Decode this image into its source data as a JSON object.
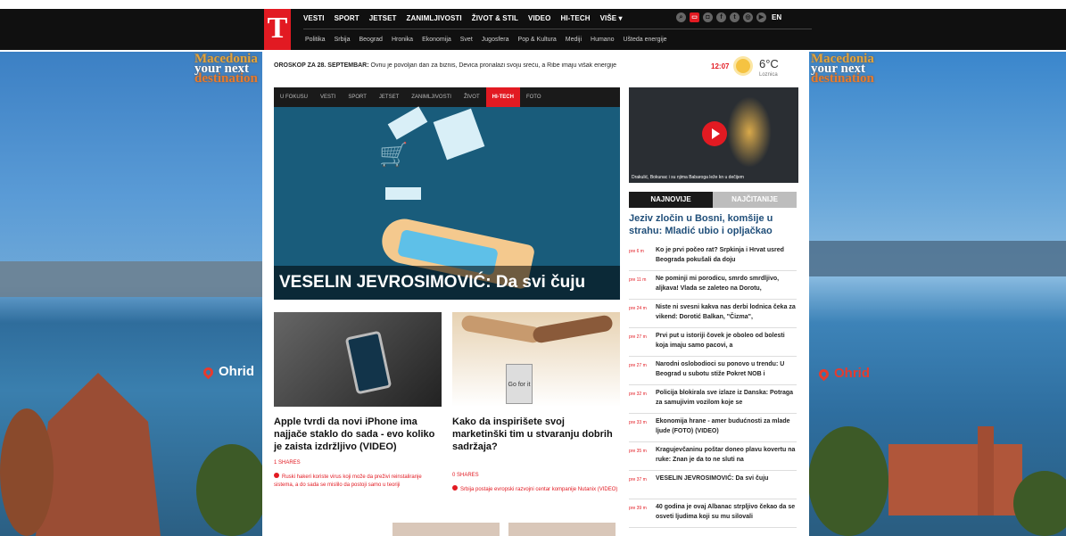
{
  "ad": {
    "brand_line1": "Macedonia",
    "brand_line2": "your next",
    "brand_line3": "destination",
    "pin_label": "Ohrid"
  },
  "header": {
    "logo": "T",
    "nav_main": [
      "VESTI",
      "SPORT",
      "JETSET",
      "ZANIMLJIVOSTI",
      "ŽIVOT & STIL",
      "VIDEO",
      "HI-TECH",
      "VIŠE ▾"
    ],
    "nav_sub": [
      "Politika",
      "Srbija",
      "Beograd",
      "Hronika",
      "Ekonomija",
      "Svet",
      "Jugosfera",
      "Pop & Kultura",
      "Mediji",
      "Humano",
      "Ušteda energije"
    ],
    "lang": "EN"
  },
  "ticker": {
    "label": "OROSKOP ZA 28. SEPTEMBAR:",
    "text": " Ovnu je povoljan dan za biznis, Devica pronalazi svoju sreću, a Ribe imaju višak energije",
    "time": "12:07"
  },
  "weather": {
    "temp": "6°C",
    "city": "Loznica"
  },
  "hero": {
    "tabs": [
      "U FOKUSU",
      "VESTI",
      "SPORT",
      "JETSET",
      "ZANIMLJIVOSTI",
      "ŽIVOT",
      "HI-TECH",
      "FOTO"
    ],
    "active_tab": "HI-TECH",
    "title": "VESELIN JEVROSIMOVIĆ: Da svi čuju"
  },
  "video": {
    "caption": "Drakulić, Bokunac i su njima Babaroga leže kn u dečijem"
  },
  "right": {
    "tab_latest": "NAJNOVIJE",
    "tab_read": "NAJČITANIJE",
    "headline": "Jeziv zločin u Bosni, komšije u strahu: Mladić ubio i opljačkao",
    "items": [
      {
        "time": "pre 6 m",
        "text": "Ko je prvi počeo rat? Srpkinja i Hrvat usred Beograda pokušali da doju"
      },
      {
        "time": "pre 11 m",
        "text": "Ne pominji mi porodicu, smrdo smrdljivo, aljkava! Vlada se zaleteo na Dorotu,"
      },
      {
        "time": "pre 24 m",
        "text": "Niste ni svesni kakva nas derbi lodnica čeka za vikend: Dorotić Balkan, \"Čizma\","
      },
      {
        "time": "pre 27 m",
        "text": "Prvi put u istoriji čovek je oboleo od bolesti koja imaju samo pacovi, a"
      },
      {
        "time": "pre 27 m",
        "text": "Narodni oslobodioci su ponovo u trendu: U Beograd u subotu stiže Pokret NOB i"
      },
      {
        "time": "pre 32 m",
        "text": "Policija blokirala sve izlaze iz Danska: Potraga za samujivim vozilom koje se"
      },
      {
        "time": "pre 33 m",
        "text": "Ekonomija hrane - amer budućnosti za mlade ljude (FOTO) (VIDEO)"
      },
      {
        "time": "pre 35 m",
        "text": "Kragujevčaninu poštar doneo plavu kovertu na ruke: Znan je da to ne sluti na"
      },
      {
        "time": "pre 37 m",
        "text": "VESELIN JEVROSIMOVIĆ: Da svi čuju"
      },
      {
        "time": "pre 39 m",
        "text": "40 godina je ovaj Albanac strpljivo čekao da se osveti ljudima koji su mu silovali"
      }
    ]
  },
  "cards": [
    {
      "title": "Apple tvrdi da novi iPhone ima najjače staklo do sada - evo koliko je zaista izdržljivo (VIDEO)",
      "shares": "1 SHARES",
      "note": "Ruski hakeri koriste virus koji može da preživi reinstaliranje sistema, a do sada se mislilo da postoji samo u teoriji"
    },
    {
      "title": "Kako da inspirišete svoj marketinški tim u stvaranju dobrih sadržaja?",
      "shares": "0 SHARES",
      "note": "Srbija postaje evropski razvojni centar kompanije Nutanix (VIDEO)",
      "cup": "Go for it"
    }
  ],
  "colors": {
    "brand_red": "#e21a22",
    "topbar": "#101010",
    "headline_blue": "#1f4e79"
  }
}
